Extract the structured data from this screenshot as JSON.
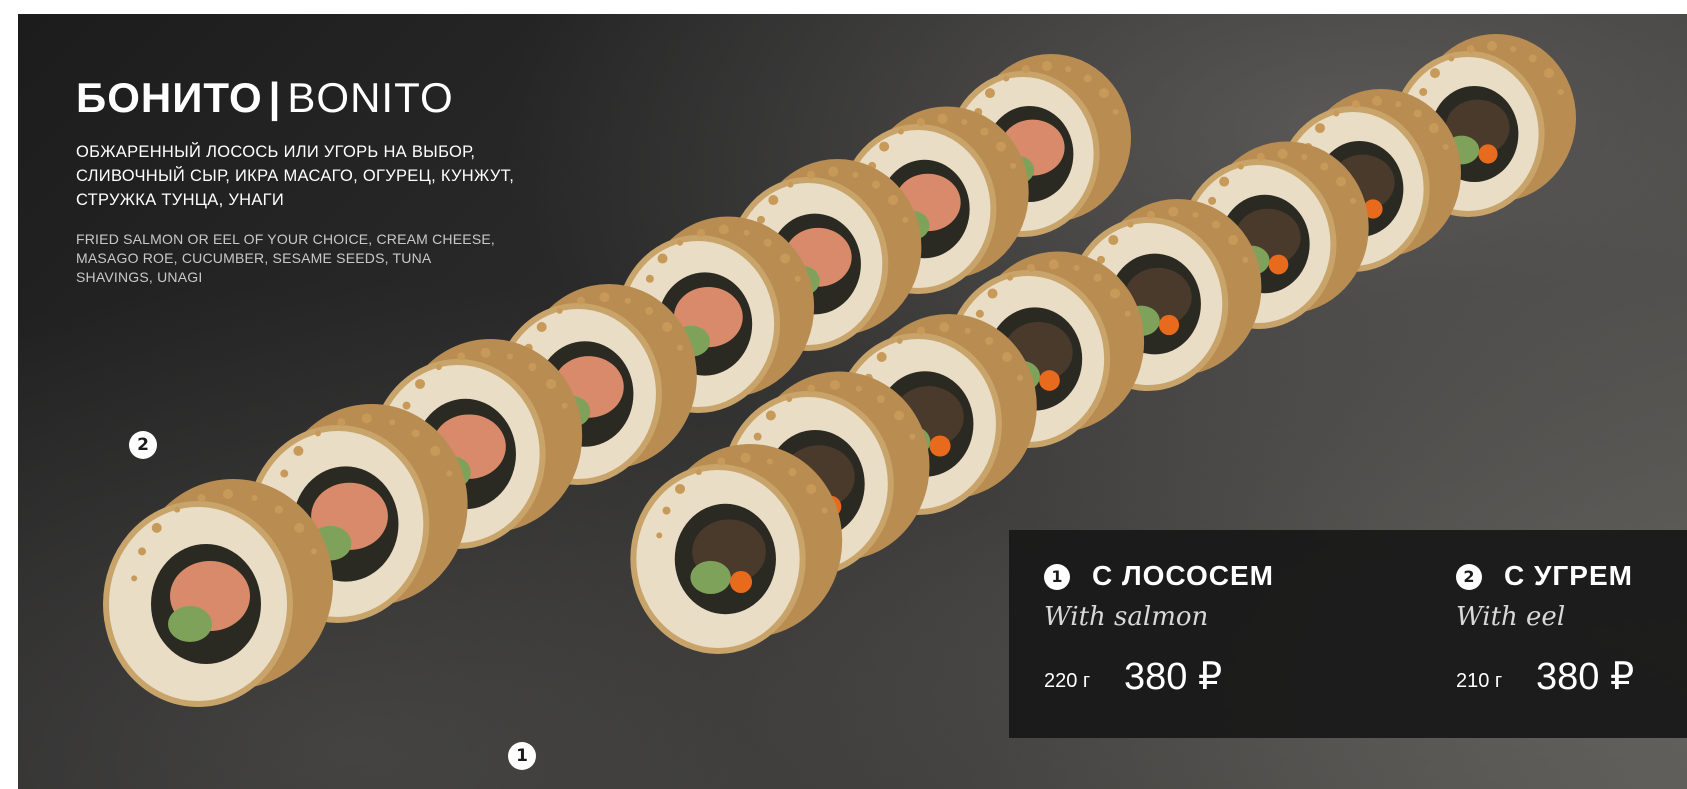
{
  "product": {
    "title_ru": "БОНИТО",
    "title_sep": "|",
    "title_en": "BONITO",
    "description_ru": "ОБЖАРЕННЫЙ ЛОСОСЬ ИЛИ УГОРЬ НА ВЫБОР, СЛИВОЧНЫЙ СЫР, ИКРА МАСАГО, ОГУРЕЦ, КУНЖУТ, СТРУЖКА ТУНЦА, УНАГИ",
    "description_en": "FRIED SALMON OR EEL OF YOUR CHOICE, CREAM CHEESE, MASAGO ROE, CUCUMBER, SESAME SEEDS, TUNA SHAVINGS, UNAGI"
  },
  "photo_markers": [
    {
      "label": "2"
    },
    {
      "label": "1"
    }
  ],
  "variants": [
    {
      "number": "1",
      "name": "С ЛОСОСЕМ",
      "subtitle": "With salmon",
      "weight": "220 г",
      "price": "380 ₽"
    },
    {
      "number": "2",
      "name": "С УГРЕМ",
      "subtitle": "With eel",
      "weight": "210 г",
      "price": "380 ₽"
    }
  ],
  "colors": {
    "panel": "#181818",
    "text": "#ffffff",
    "rice": "#e9ddc6",
    "crumb": "#c89a5a",
    "salmon": "#d98a6a",
    "eel": "#4a3a2c",
    "cucumber": "#7fa25a",
    "masago": "#e86a1c"
  }
}
